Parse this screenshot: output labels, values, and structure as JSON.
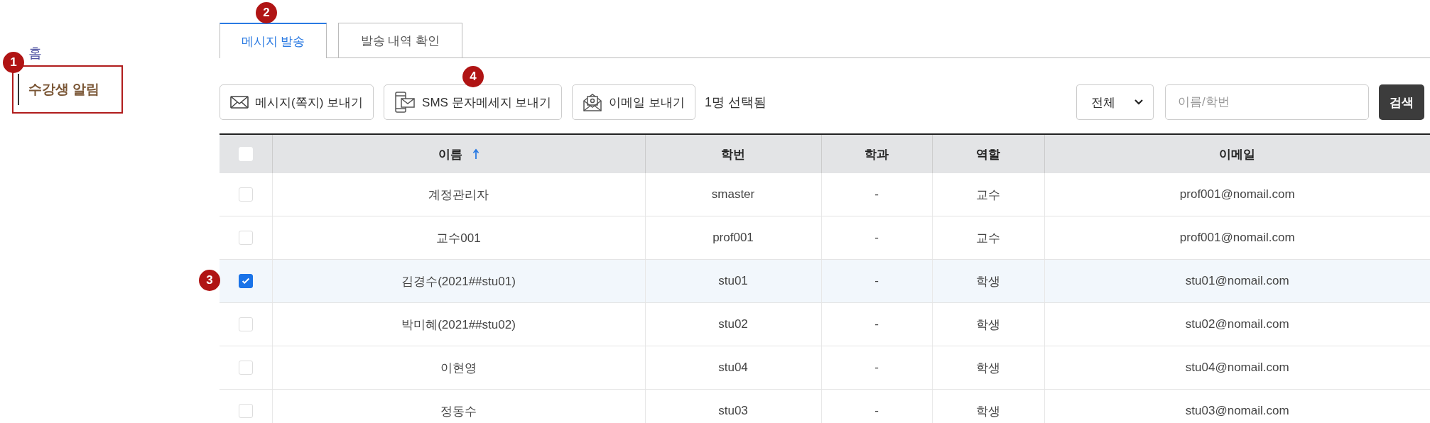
{
  "sidebar": {
    "items": [
      {
        "label": "홈",
        "selected": false
      },
      {
        "label": "수강생 알림",
        "selected": true,
        "highlighted": true,
        "badge": "1"
      }
    ]
  },
  "tabs": [
    {
      "label": "메시지 발송",
      "selected": true,
      "badge": "2"
    },
    {
      "label": "발송 내역 확인",
      "selected": false
    }
  ],
  "toolbar": {
    "buttons": [
      {
        "label": "메시지(쪽지) 보내기",
        "kind": "message"
      },
      {
        "label": "SMS 문자메세지 보내기",
        "kind": "sms",
        "badge": "4"
      },
      {
        "label": "이메일 보내기",
        "kind": "email"
      }
    ],
    "selection_count": "1명 선택됨",
    "filter": {
      "value": "전체"
    },
    "search": {
      "placeholder": "이름/학번"
    },
    "search_button": "검색"
  },
  "table": {
    "all_checked": false,
    "columns": [
      {
        "label": "이름",
        "sorted": true
      },
      {
        "label": "학번",
        "sorted": false
      },
      {
        "label": "학과",
        "sorted": false
      },
      {
        "label": "역할",
        "sorted": false
      },
      {
        "label": "이메일",
        "sorted": false
      }
    ],
    "rows": [
      {
        "checked": false,
        "cells": [
          "계정관리자",
          "smaster",
          "-",
          "교수",
          "prof001@nomail.com"
        ]
      },
      {
        "checked": false,
        "cells": [
          "교수001",
          "prof001",
          "-",
          "교수",
          "prof001@nomail.com"
        ]
      },
      {
        "checked": true,
        "badge": "3",
        "cells": [
          "김경수(2021##stu01)",
          "stu01",
          "-",
          "학생",
          "stu01@nomail.com"
        ]
      },
      {
        "checked": false,
        "cells": [
          "박미혜(2021##stu02)",
          "stu02",
          "-",
          "학생",
          "stu02@nomail.com"
        ]
      },
      {
        "checked": false,
        "cells": [
          "이현영",
          "stu04",
          "-",
          "학생",
          "stu04@nomail.com"
        ]
      },
      {
        "checked": false,
        "cells": [
          "정동수",
          "stu03",
          "-",
          "학생",
          "stu03@nomail.com"
        ]
      }
    ]
  }
}
